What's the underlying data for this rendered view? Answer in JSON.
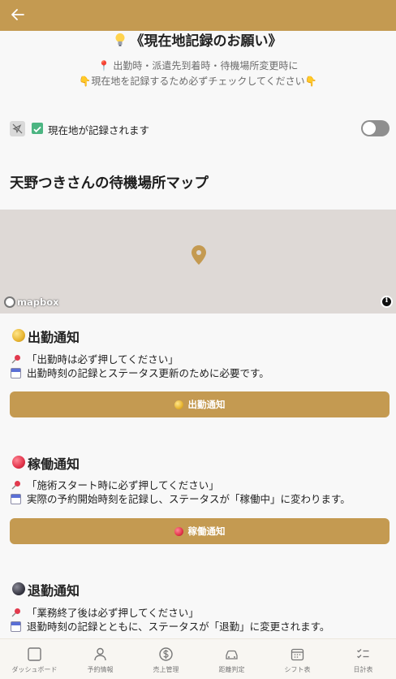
{
  "header": {
    "back_icon": "arrow-left-icon",
    "color": "#c49a51"
  },
  "request": {
    "title": "《現在地記録のお願い》",
    "title_icon": "lightbulb-icon",
    "line1": "📍 出勤時・派遣先到着時・待機場所変更時に",
    "line2": "👇現在地を記録するため必ずチェックしてください👇"
  },
  "location": {
    "label": "現在地が記録されます",
    "checkbox_checked": true,
    "toggle_on": false
  },
  "map": {
    "title": "天野つきさんの待機場所マップ",
    "attribution": "mapbox",
    "info_symbol": "i"
  },
  "sections": [
    {
      "icon": "yellow-circle-icon",
      "title": "出勤通知",
      "note1": "「出勤時は必ず押してください」",
      "note2": "出勤時刻の記録とステータス更新のために必要です。",
      "button_label": "出勤通知"
    },
    {
      "icon": "red-circle-icon",
      "title": "稼働通知",
      "note1": "「施術スタート時に必ず押してください」",
      "note2": "実際の予約開始時刻を記録し、ステータスが「稼働中」に変わります。",
      "button_label": "稼働通知"
    },
    {
      "icon": "black-circle-icon",
      "title": "退勤通知",
      "note1": "「業務終了後は必ず押してください」",
      "note2": "退勤時刻の記録とともに、ステータスが「退勤」に変更されます。"
    }
  ],
  "nav": [
    {
      "label": "ダッシュボード",
      "icon": "square-icon"
    },
    {
      "label": "予約情報",
      "icon": "user-icon"
    },
    {
      "label": "売上管理",
      "icon": "dollar-circle-icon"
    },
    {
      "label": "距離判定",
      "icon": "car-icon"
    },
    {
      "label": "シフト表",
      "icon": "calendar-icon"
    },
    {
      "label": "日計表",
      "icon": "checklist-icon"
    }
  ],
  "colors": {
    "accent": "#c49a51",
    "background": "#f8f8f8",
    "map": "#ded9d6",
    "check": "#4cb582"
  }
}
